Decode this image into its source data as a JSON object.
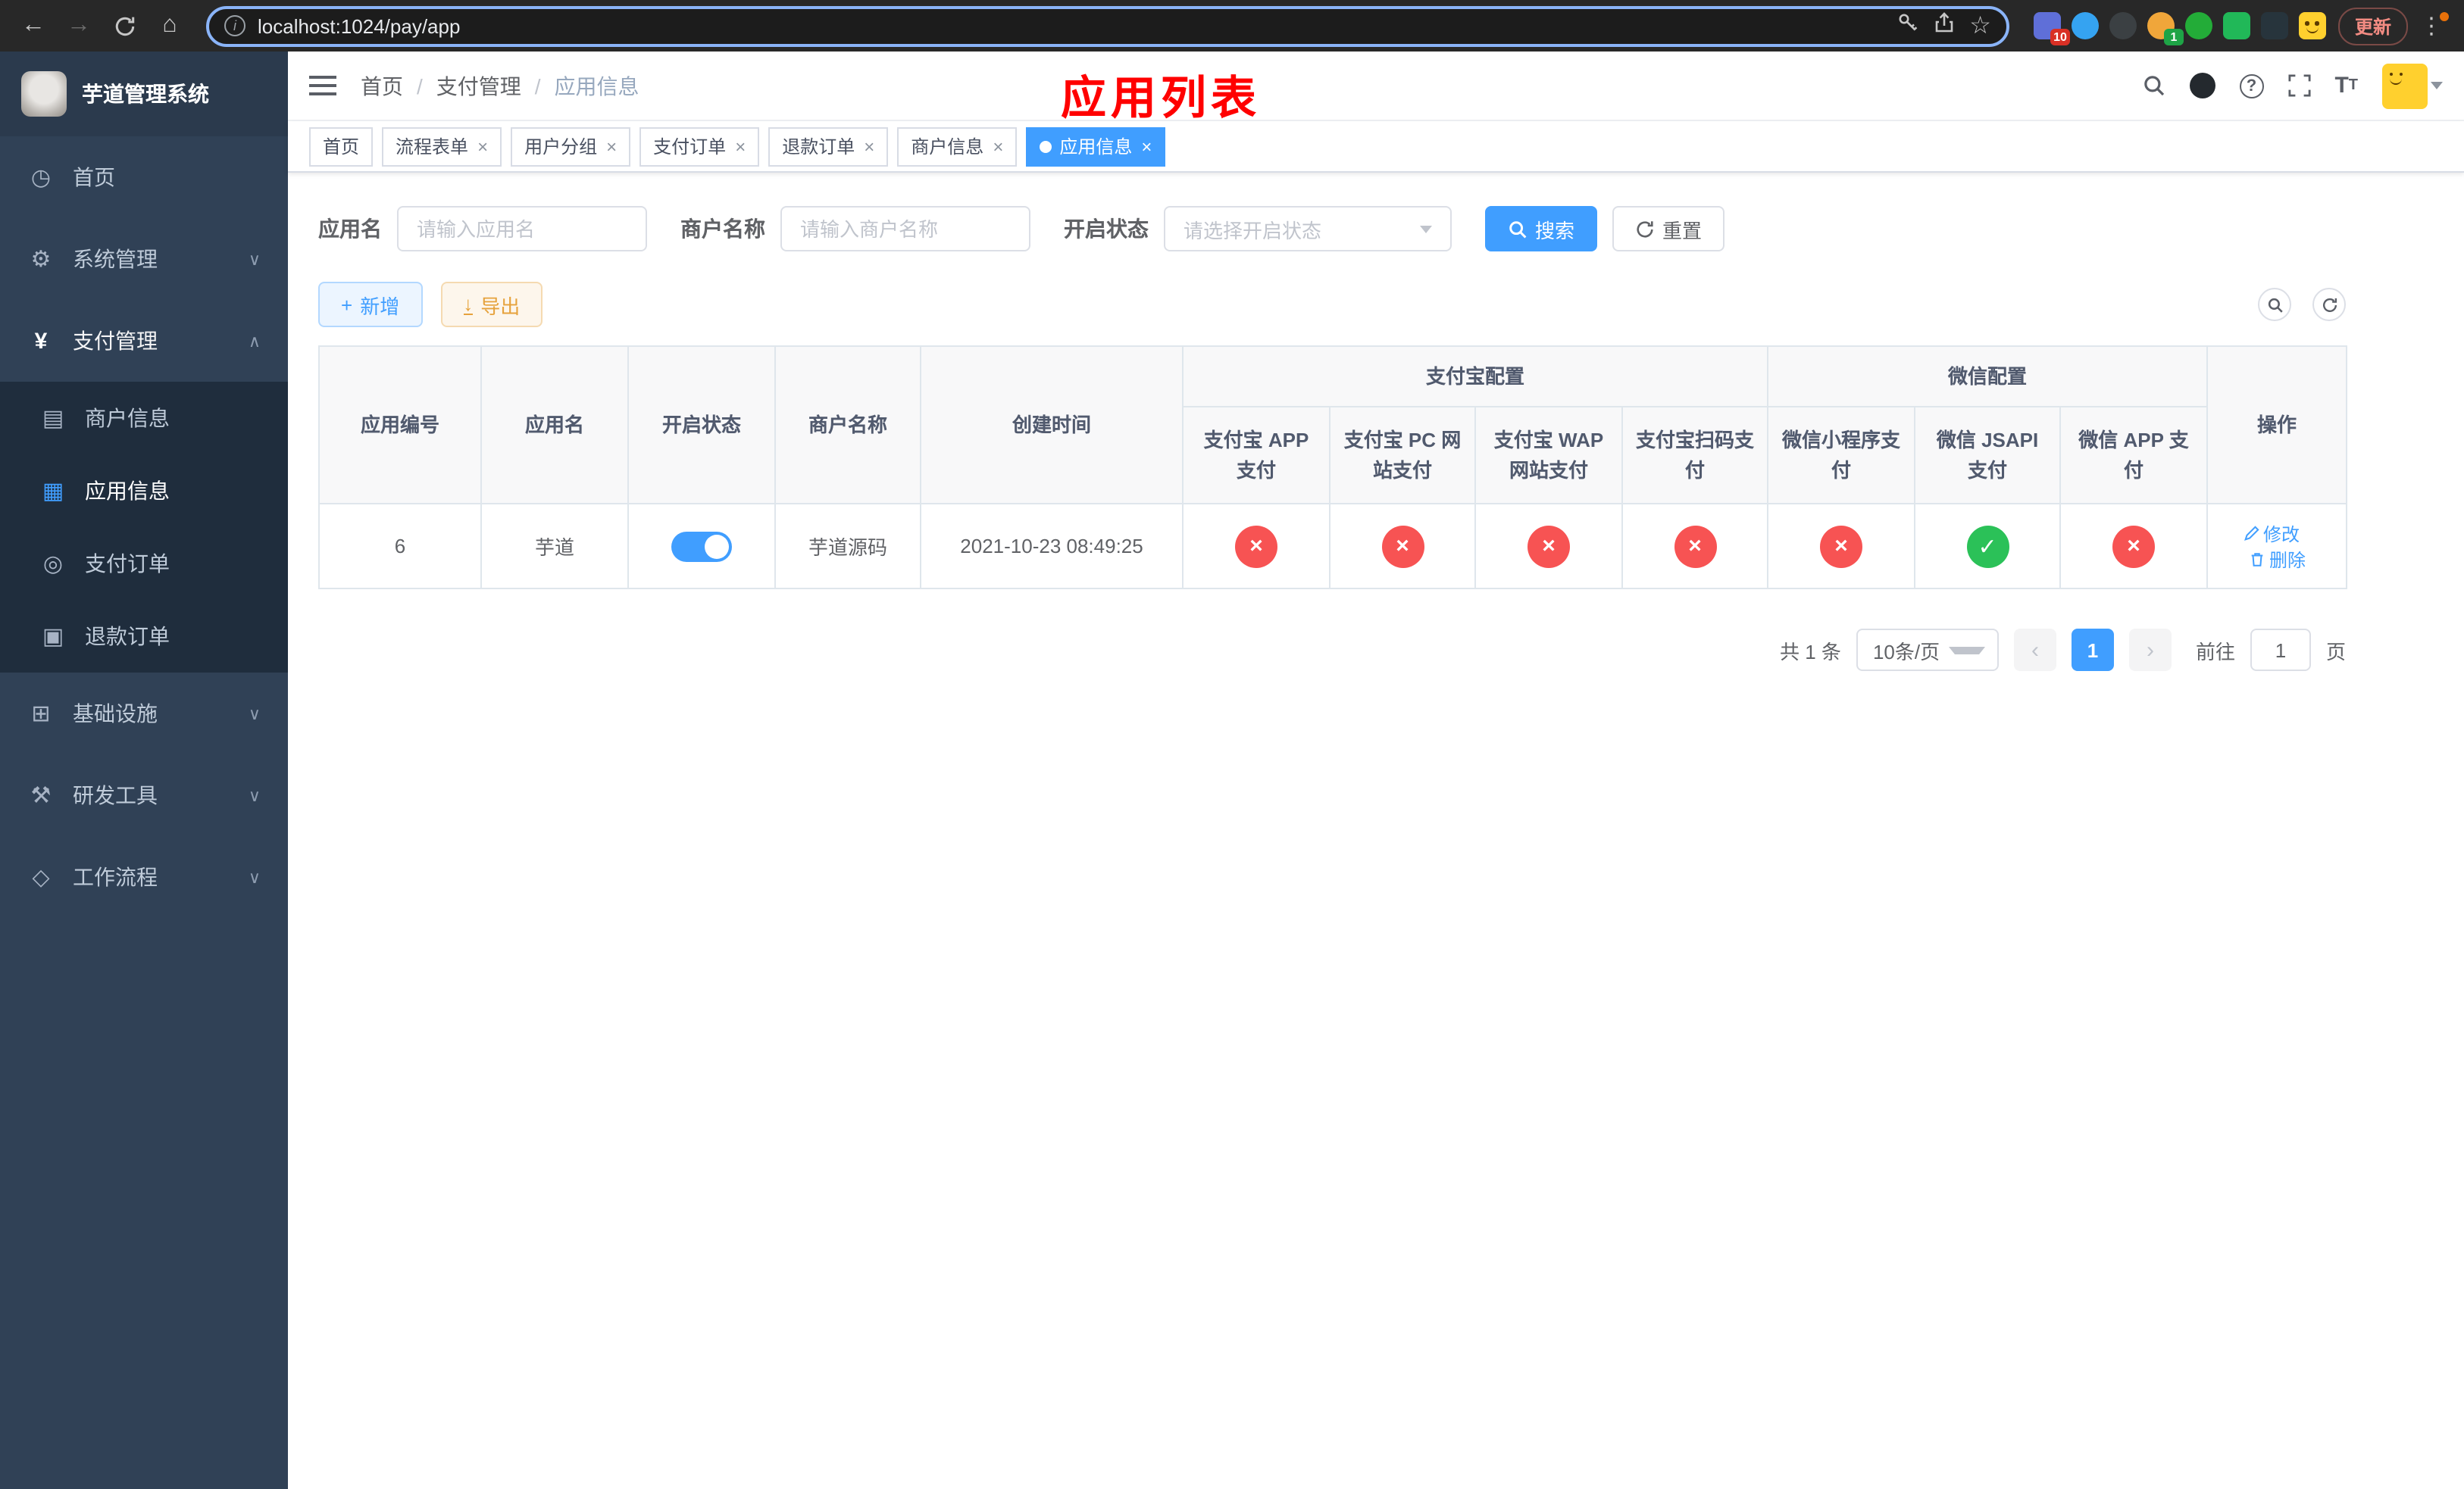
{
  "browser": {
    "url": "localhost:1024/pay/app",
    "update_label": "更新",
    "ext_badge_10": "10",
    "ext_badge_1": "1"
  },
  "icons": {
    "back": "←",
    "forward": "→",
    "home": "⌂",
    "star": "☆",
    "kebab": "⋮",
    "info": "i",
    "question": "?",
    "font_big": "T",
    "font_small": "T",
    "dashboard": "◷",
    "gear": "⚙",
    "yen": "¥",
    "card": "▤",
    "grid": "▦",
    "order": "◎",
    "refund": "▣",
    "infra": "⊞",
    "tools": "⚒",
    "flow": "◇",
    "chevron_down": "∨",
    "chevron_up": "∧",
    "plus": "+",
    "download": "↓",
    "cross": "×",
    "check": "✓",
    "close": "×",
    "prev": "‹",
    "next": "›",
    "edit": "✎"
  },
  "sidebar": {
    "title": "芋道管理系统",
    "items": [
      {
        "label": "首页"
      },
      {
        "label": "系统管理"
      },
      {
        "label": "支付管理"
      },
      {
        "label": "基础设施"
      },
      {
        "label": "研发工具"
      },
      {
        "label": "工作流程"
      }
    ],
    "pay_children": [
      {
        "label": "商户信息"
      },
      {
        "label": "应用信息"
      },
      {
        "label": "支付订单"
      },
      {
        "label": "退款订单"
      }
    ]
  },
  "header": {
    "breadcrumb": [
      {
        "label": "首页"
      },
      {
        "label": "支付管理"
      },
      {
        "label": "应用信息"
      }
    ],
    "separator": "/",
    "annotation_title": "应用列表"
  },
  "tabs": [
    {
      "label": "首页"
    },
    {
      "label": "流程表单"
    },
    {
      "label": "用户分组"
    },
    {
      "label": "支付订单"
    },
    {
      "label": "退款订单"
    },
    {
      "label": "商户信息"
    },
    {
      "label": "应用信息"
    }
  ],
  "filters": {
    "app_name_label": "应用名",
    "app_name_placeholder": "请输入应用名",
    "merchant_label": "商户名称",
    "merchant_placeholder": "请输入商户名称",
    "status_label": "开启状态",
    "status_placeholder": "请选择开启状态",
    "search_button": "搜索",
    "reset_button": "重置"
  },
  "toolbar": {
    "add_button": "新增",
    "export_button": "导出"
  },
  "table": {
    "headers": {
      "app_id": "应用编号",
      "app_name": "应用名",
      "status": "开启状态",
      "merchant": "商户名称",
      "created": "创建时间",
      "alipay_group": "支付宝配置",
      "wechat_group": "微信配置",
      "alipay_app": "支付宝 APP 支付",
      "alipay_pc": "支付宝 PC 网站支付",
      "alipay_wap": "支付宝 WAP 网站支付",
      "alipay_qr": "支付宝扫码支付",
      "wechat_mini": "微信小程序支付",
      "wechat_jsapi": "微信 JSAPI 支付",
      "wechat_app": "微信 APP 支付",
      "actions": "操作"
    },
    "rows": [
      {
        "app_id": "6",
        "app_name": "芋道",
        "status_enabled": true,
        "merchant": "芋道源码",
        "created": "2021-10-23 08:49:25",
        "alipay_app": false,
        "alipay_pc": false,
        "alipay_wap": false,
        "alipay_qr": false,
        "wechat_mini": false,
        "wechat_jsapi": true,
        "wechat_app": false,
        "edit_label": "修改",
        "delete_label": "删除"
      }
    ]
  },
  "pagination": {
    "total": "共 1 条",
    "page_size": "10条/页",
    "page": "1",
    "goto_label": "前往",
    "goto_value": "1",
    "unit_label": "页"
  },
  "colors": {
    "primary": "#409eff",
    "danger_red": "#f75353",
    "success_green": "#2bc158",
    "annotation_red": "#ff0000",
    "sidebar_bg": "#304156",
    "submenu_bg": "#1f2d3d"
  }
}
